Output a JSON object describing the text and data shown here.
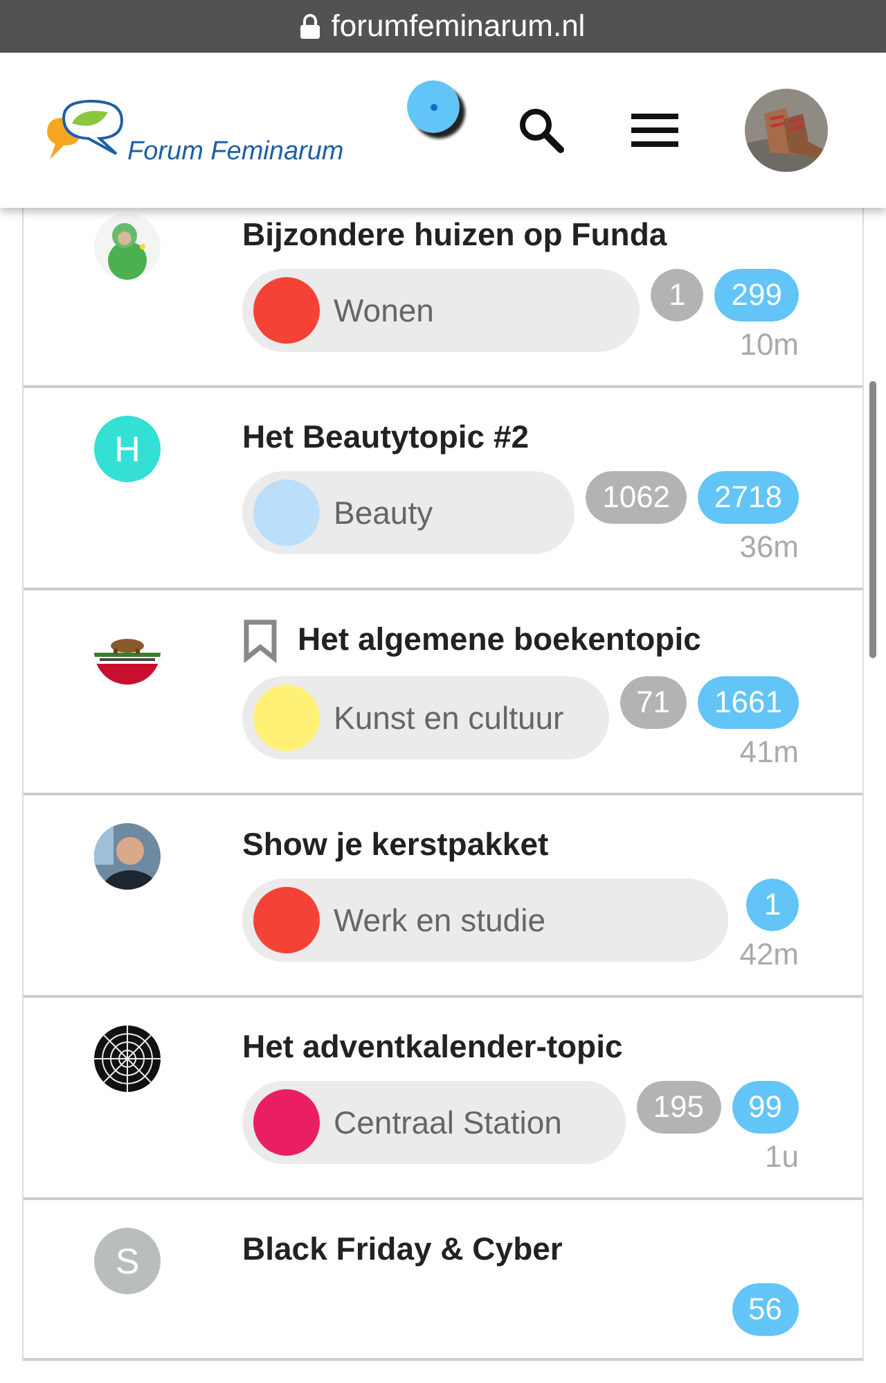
{
  "browser": {
    "url": "forumfeminarum.nl"
  },
  "header": {
    "site_name": "Forum Feminarum",
    "has_notification": true
  },
  "topics": [
    {
      "title": "Bijzondere huizen op Funda",
      "bookmarked": false,
      "category": {
        "name": "Wonen",
        "color": "#f44336"
      },
      "time": "10m",
      "unread": "1",
      "replies": "299"
    },
    {
      "title": "Het Beautytopic #2",
      "bookmarked": false,
      "avatar": {
        "kind": "letter",
        "letter": "H",
        "color": "#33e0d3"
      },
      "category": {
        "name": "Beauty",
        "color": "#bbdefb"
      },
      "time": "36m",
      "unread": "1062",
      "replies": "2718"
    },
    {
      "title": "Het algemene boekentopic",
      "bookmarked": true,
      "category": {
        "name": "Kunst en cultuur",
        "color": "#fff176"
      },
      "time": "41m",
      "unread": "71",
      "replies": "1661"
    },
    {
      "title": "Show je kerstpakket",
      "bookmarked": false,
      "avatar": {
        "kind": "person"
      },
      "category": {
        "name": "Werk en studie",
        "color": "#f44336"
      },
      "time": "42m",
      "replies": "1"
    },
    {
      "title": "Het adventkalender-topic",
      "bookmarked": false,
      "category": {
        "name": "Centraal Station",
        "color": "#e91e63"
      },
      "time": "1u",
      "unread": "195",
      "replies": "99"
    },
    {
      "title": "Black Friday & Cyber",
      "bookmarked": false,
      "avatar": {
        "kind": "letter",
        "letter": "S",
        "color": "#b8bebe"
      },
      "replies": "56"
    }
  ]
}
